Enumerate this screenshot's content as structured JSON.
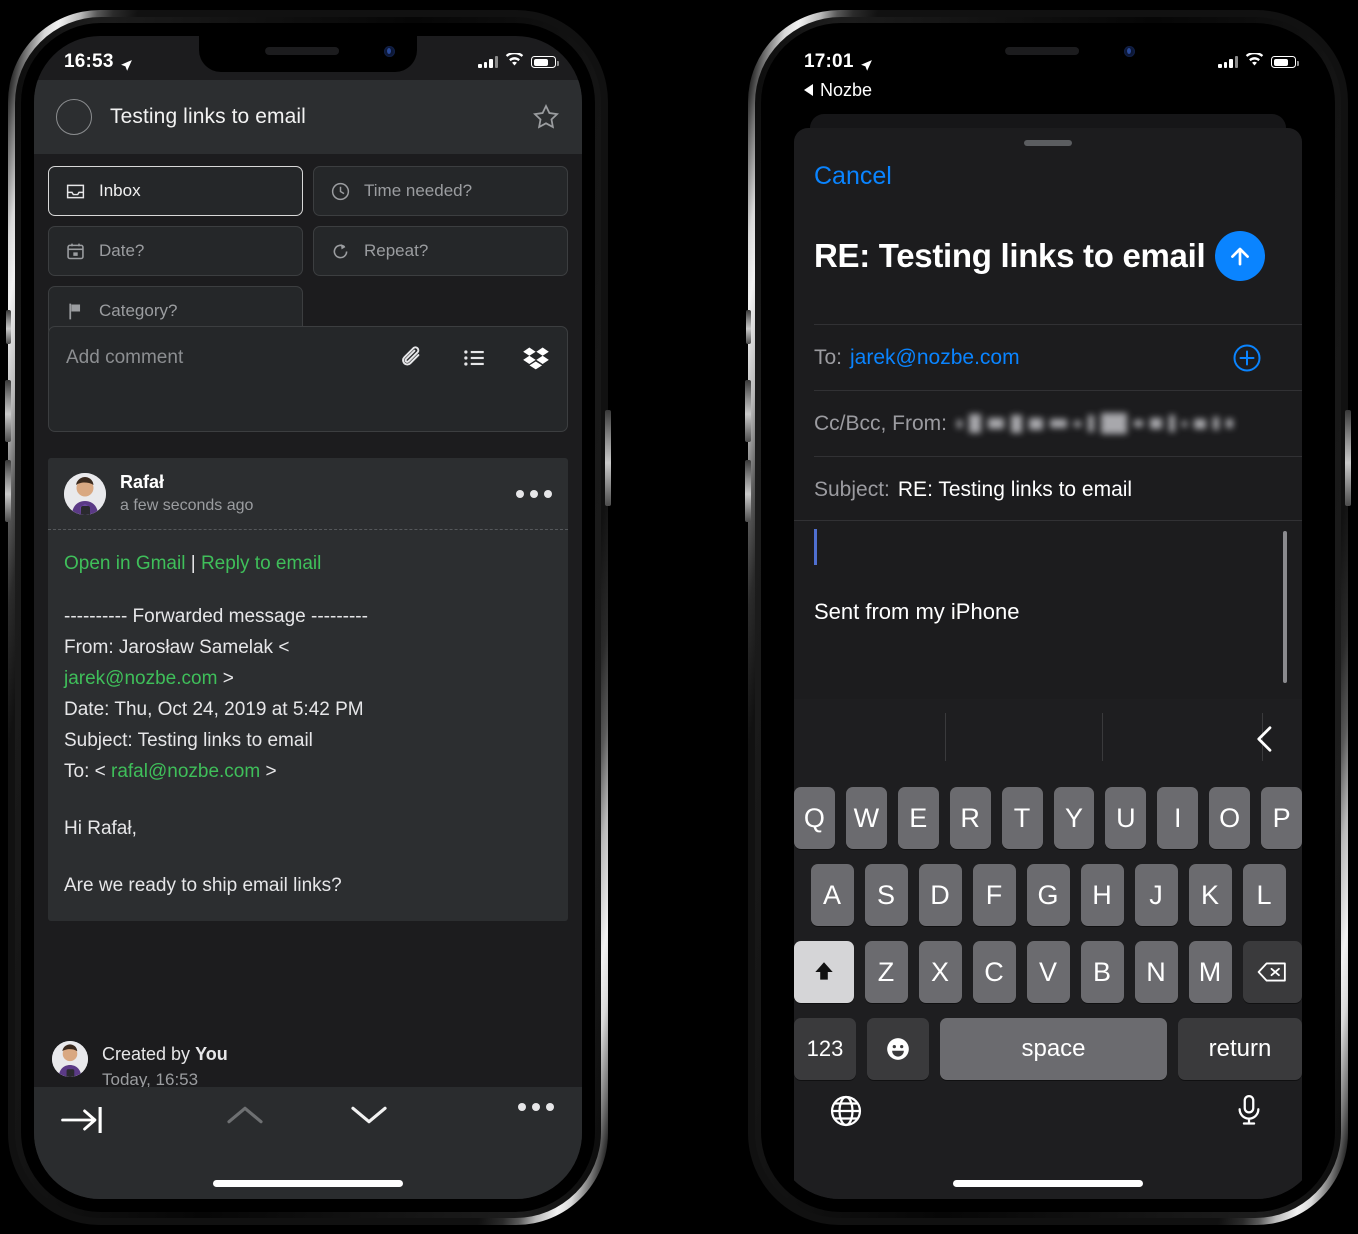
{
  "left_phone": {
    "status_bar": {
      "time": "16:53",
      "location_icon": "location-arrow-icon",
      "signal_icon": "cellular-bars-icon",
      "wifi_icon": "wifi-icon",
      "battery_icon": "battery-icon"
    },
    "task_header": {
      "checkbox_icon": "task-checkbox-icon",
      "title": "Testing links to email",
      "star_icon": "star-outline-icon"
    },
    "attributes": [
      {
        "icon": "inbox-icon",
        "label": "Inbox",
        "active": true
      },
      {
        "icon": "clock-icon",
        "label": "Time needed?",
        "active": false
      },
      {
        "icon": "calendar-icon",
        "label": "Date?",
        "active": false
      },
      {
        "icon": "repeat-icon",
        "label": "Repeat?",
        "active": false
      },
      {
        "icon": "flag-icon",
        "label": "Category?",
        "active": false
      }
    ],
    "comment_input": {
      "placeholder": "Add comment",
      "tools": [
        {
          "icon": "paperclip-icon",
          "name": "attachment"
        },
        {
          "icon": "checklist-icon",
          "name": "checklist"
        },
        {
          "icon": "dropbox-icon",
          "name": "dropbox"
        }
      ]
    },
    "comment": {
      "author": "Rafał",
      "timestamp": "a few seconds ago",
      "menu_icon": "more-options-icon",
      "actions": {
        "open_in_gmail": "Open in Gmail",
        "separator": "|",
        "reply_to_email": "Reply to email"
      },
      "body_lines": [
        {
          "text": "---------- Forwarded message ---------",
          "type": "plain"
        },
        {
          "text": "From: Jarosław Samelak <",
          "type": "plain"
        },
        {
          "text": "jarek@nozbe.com",
          "type": "link",
          "suffix": " >"
        },
        {
          "text": "Date: Thu, Oct 24, 2019 at 5:42 PM",
          "type": "plain"
        },
        {
          "text": "Subject: Testing links to email",
          "type": "plain"
        },
        {
          "prefix": "To: < ",
          "text": "rafal@nozbe.com",
          "type": "link",
          "suffix": " >"
        },
        {
          "text": "",
          "type": "blank"
        },
        {
          "text": "Hi Rafał,",
          "type": "plain"
        },
        {
          "text": "",
          "type": "blank"
        },
        {
          "text": "Are we ready to ship email links?",
          "type": "plain"
        }
      ]
    },
    "created_by": {
      "prefix": "Created by ",
      "who": "You",
      "when": "Today, 16:53"
    },
    "bottom_bar": [
      {
        "icon": "indent-cursor-icon",
        "name": "add-subtask"
      },
      {
        "icon": "chevron-up-icon",
        "name": "previous-task"
      },
      {
        "icon": "chevron-down-icon",
        "name": "next-task"
      },
      {
        "icon": "more-options-icon",
        "name": "task-menu"
      }
    ]
  },
  "right_phone": {
    "status_bar": {
      "time": "17:01",
      "location_icon": "location-arrow-icon",
      "signal_icon": "cellular-bars-icon",
      "wifi_icon": "wifi-icon",
      "battery_icon": "battery-icon"
    },
    "back_link": {
      "icon": "back-triangle-icon",
      "label": "Nozbe"
    },
    "compose": {
      "cancel_label": "Cancel",
      "title": "RE: Testing links to email",
      "send_icon": "send-arrow-up-icon",
      "to_label": "To:",
      "to_value": "jarek@nozbe.com",
      "add_recipient_icon": "add-contact-plus-icon",
      "ccbcc_label": "Cc/Bcc, From:",
      "ccbcc_value_redacted": true,
      "subject_label": "Subject:",
      "subject_value": "RE: Testing links to email",
      "body_text": "",
      "signature": "Sent from my iPhone"
    },
    "keyboard": {
      "predictive_chevron_icon": "chevron-left-icon",
      "row1": [
        "Q",
        "W",
        "E",
        "R",
        "T",
        "Y",
        "U",
        "I",
        "O",
        "P"
      ],
      "row2": [
        "A",
        "S",
        "D",
        "F",
        "G",
        "H",
        "J",
        "K",
        "L"
      ],
      "row3": [
        "Z",
        "X",
        "C",
        "V",
        "B",
        "N",
        "M"
      ],
      "shift_icon": "shift-up-icon",
      "backspace_icon": "backspace-delete-icon",
      "numbers_label": "123",
      "emoji_icon": "emoji-smiley-icon",
      "space_label": "space",
      "return_label": "return",
      "globe_icon": "globe-language-icon",
      "mic_icon": "microphone-dictation-icon"
    }
  },
  "colors": {
    "accent_blue": "#0a84ff",
    "link_green": "#3fbf5a",
    "caret_blue": "#4f6fd0",
    "panel": "#2c2e30",
    "app_bg": "#1c1c1e"
  }
}
